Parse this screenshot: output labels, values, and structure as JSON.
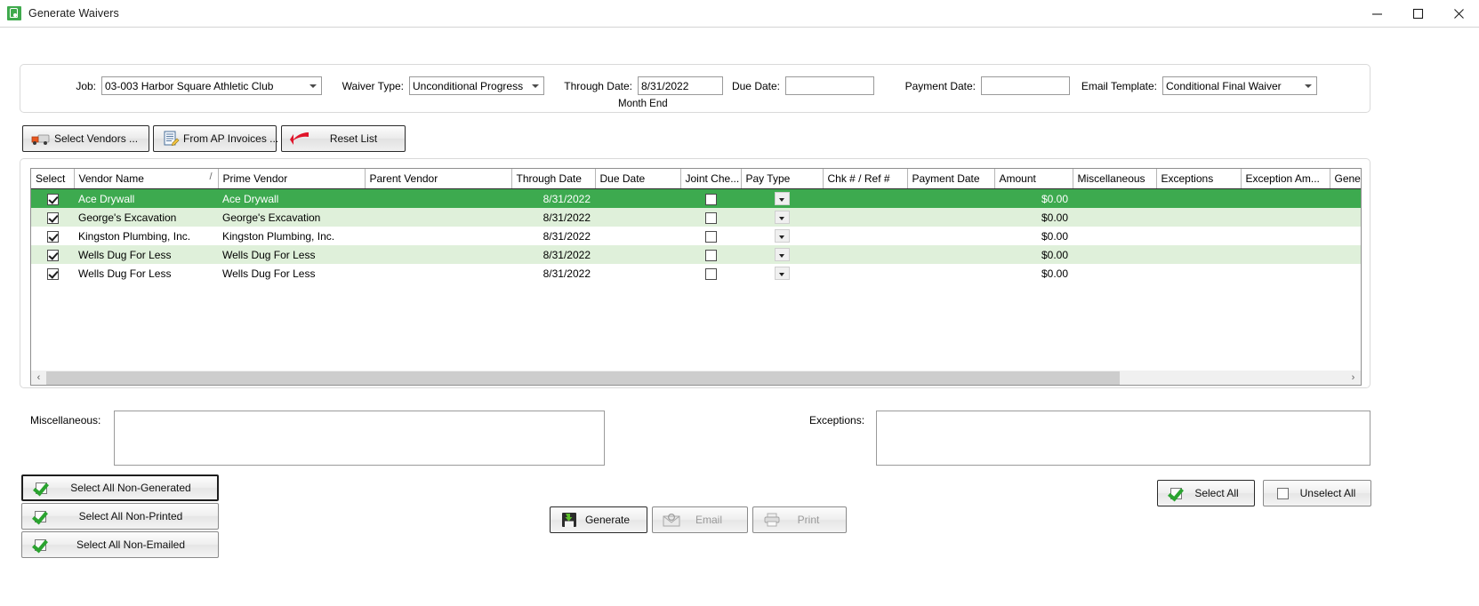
{
  "window": {
    "title": "Generate Waivers",
    "app_icon": "generate-waivers-icon",
    "minimize": "—",
    "maximize": "□",
    "close": "✕"
  },
  "filters": {
    "job_label": "Job:",
    "job_value": "03-003  Harbor Square Athletic Club",
    "waiver_type_label": "Waiver Type:",
    "waiver_type_value": "Unconditional Progress",
    "through_date_label": "Through Date:",
    "through_date_value": "8/31/2022",
    "through_date_note": "Month End",
    "due_date_label": "Due Date:",
    "due_date_value": "",
    "payment_date_label": "Payment Date:",
    "payment_date_value": "",
    "email_template_label": "Email Template:",
    "email_template_value": "Conditional Final Waiver"
  },
  "toolbar": {
    "select_vendors": "Select Vendors ...",
    "from_ap_invoices": "From AP Invoices ...",
    "reset_list": "Reset List"
  },
  "grid": {
    "columns": [
      "Select",
      "Vendor Name",
      "Prime Vendor",
      "Parent Vendor",
      "Through Date",
      "Due Date",
      "Joint Che...",
      "Pay Type",
      "Chk # / Ref #",
      "Payment Date",
      "Amount",
      "Miscellaneous",
      "Exceptions",
      "Exception Am...",
      "Gener"
    ],
    "sort_indicator": "/",
    "rows": [
      {
        "select": true,
        "vendor_name": "Ace Drywall",
        "prime_vendor": "Ace Drywall",
        "parent_vendor": "",
        "through_date": "8/31/2022",
        "due_date": "",
        "joint_check": false,
        "pay_type": "",
        "chk_ref": "",
        "payment_date": "",
        "amount": "$0.00",
        "miscellaneous": "",
        "exceptions": "",
        "exception_amount": "",
        "generated": "",
        "selected_row": true
      },
      {
        "select": true,
        "vendor_name": "George's Excavation",
        "prime_vendor": "George's Excavation",
        "parent_vendor": "",
        "through_date": "8/31/2022",
        "due_date": "",
        "joint_check": false,
        "pay_type": "",
        "chk_ref": "",
        "payment_date": "",
        "amount": "$0.00",
        "miscellaneous": "",
        "exceptions": "",
        "exception_amount": "",
        "generated": "",
        "selected_row": false
      },
      {
        "select": true,
        "vendor_name": "Kingston Plumbing, Inc.",
        "prime_vendor": "Kingston Plumbing, Inc.",
        "parent_vendor": "",
        "through_date": "8/31/2022",
        "due_date": "",
        "joint_check": false,
        "pay_type": "",
        "chk_ref": "",
        "payment_date": "",
        "amount": "$0.00",
        "miscellaneous": "",
        "exceptions": "",
        "exception_amount": "",
        "generated": "",
        "selected_row": false
      },
      {
        "select": true,
        "vendor_name": "Wells Dug For Less",
        "prime_vendor": "Wells Dug For Less",
        "parent_vendor": "",
        "through_date": "8/31/2022",
        "due_date": "",
        "joint_check": false,
        "pay_type": "",
        "chk_ref": "",
        "payment_date": "",
        "amount": "$0.00",
        "miscellaneous": "",
        "exceptions": "",
        "exception_amount": "",
        "generated": "",
        "selected_row": false
      },
      {
        "select": true,
        "vendor_name": "Wells Dug For Less",
        "prime_vendor": "Wells Dug For Less",
        "parent_vendor": "",
        "through_date": "8/31/2022",
        "due_date": "",
        "joint_check": false,
        "pay_type": "",
        "chk_ref": "",
        "payment_date": "",
        "amount": "$0.00",
        "miscellaneous": "",
        "exceptions": "",
        "exception_amount": "",
        "generated": "",
        "selected_row": false
      }
    ],
    "scroll_left_arrow": "‹",
    "scroll_right_arrow": "›"
  },
  "memos": {
    "miscellaneous_label": "Miscellaneous:",
    "miscellaneous_value": "",
    "exceptions_label": "Exceptions:",
    "exceptions_value": ""
  },
  "actions": {
    "select_all_non_generated": "Select All Non-Generated",
    "select_all_non_printed": "Select All Non-Printed",
    "select_all_non_emailed": "Select All Non-Emailed",
    "generate": "Generate",
    "email": "Email",
    "print": "Print",
    "select_all": "Select All",
    "unselect_all": "Unselect All"
  },
  "colors": {
    "selected_row": "#3daa4f",
    "alt_row": "#dff0da",
    "accent_green": "#2aa32f"
  }
}
